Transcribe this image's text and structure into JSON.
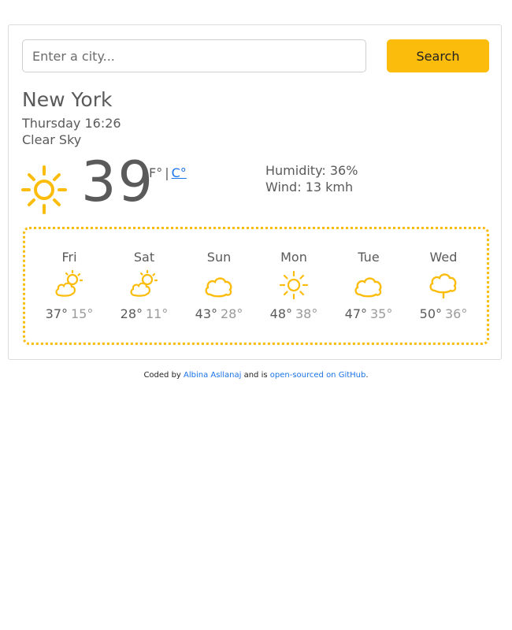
{
  "search": {
    "placeholder": "Enter a city...",
    "button_label": "Search"
  },
  "current": {
    "city": "New York",
    "date_time": "Thursday 16:26",
    "condition": "Clear Sky",
    "icon": "sun-icon",
    "temperature": "39",
    "unit_f": "F°",
    "unit_sep": "|",
    "unit_c": "C°",
    "humidity": "Humidity: 36%",
    "wind": "Wind: 13 kmh"
  },
  "forecast": [
    {
      "day": "Fri",
      "max": "37°",
      "min": "15°",
      "icon": "partly-cloudy-icon"
    },
    {
      "day": "Sat",
      "max": "28°",
      "min": "11°",
      "icon": "partly-cloudy-icon"
    },
    {
      "day": "Sun",
      "max": "43°",
      "min": "28°",
      "icon": "cloud-icon"
    },
    {
      "day": "Mon",
      "max": "48°",
      "min": "38°",
      "icon": "sun-icon"
    },
    {
      "day": "Tue",
      "max": "47°",
      "min": "35°",
      "icon": "cloud-icon"
    },
    {
      "day": "Wed",
      "max": "50°",
      "min": "36°",
      "icon": "rain-icon"
    }
  ],
  "footer": {
    "prefix": "Coded by",
    "author_link": "Albina Asllanaj",
    "middle": "and is",
    "source_link": "open-sourced on GitHub",
    "suffix": "."
  },
  "colors": {
    "accent": "#fbbc0b",
    "link": "#1a73e8",
    "text": "#5a5a5a"
  }
}
